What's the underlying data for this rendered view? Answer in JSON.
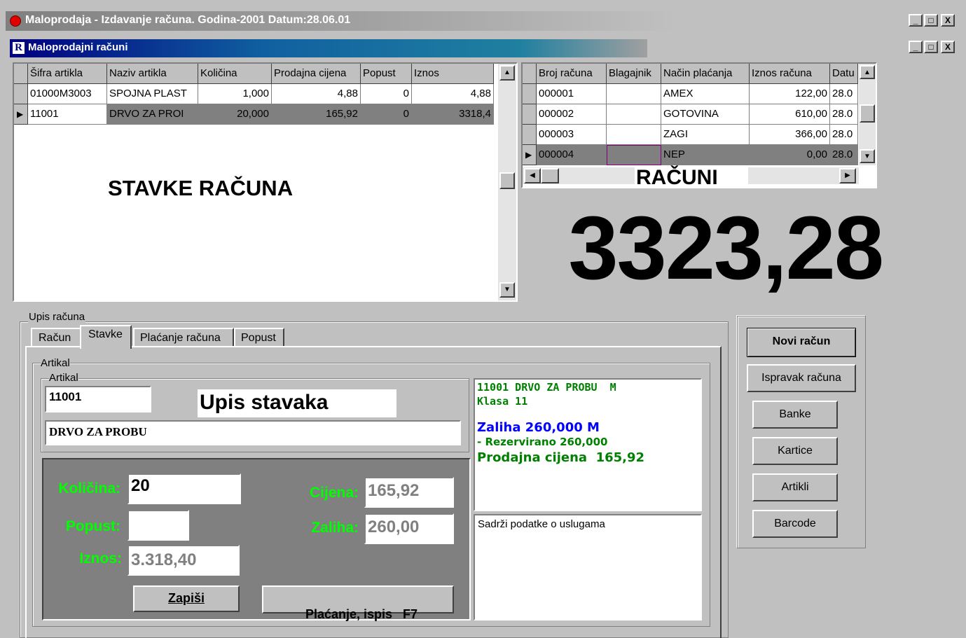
{
  "app": {
    "title": "Maloprodaja - Izdavanje računa. Godina-2001 Datum:28.06.01",
    "window_buttons": [
      "_",
      "□",
      "X"
    ]
  },
  "child": {
    "icon_letter": "R",
    "title": "Maloprodajni računi",
    "window_buttons": [
      "_",
      "□",
      "X"
    ]
  },
  "items_grid": {
    "columns": [
      "Šifra artikla",
      "Naziv artikla",
      "Količina",
      "Prodajna cijena",
      "Popust",
      "Iznos"
    ],
    "rows": [
      [
        "01000M3003",
        "SPOJNA PLAST",
        "1,000",
        "4,88",
        "0",
        "4,88"
      ],
      [
        "11001",
        "DRVO ZA PROI",
        "20,000",
        "165,92",
        "0",
        "3318,4"
      ]
    ],
    "overlay_label": "STAVKE RAČUNA"
  },
  "receipts_grid": {
    "columns": [
      "Broj računa",
      "Blagajnik",
      "Način plaćanja",
      "Iznos računa",
      "Datu"
    ],
    "rows": [
      [
        "000001",
        "",
        "AMEX",
        "122,00",
        "28.0"
      ],
      [
        "000002",
        "",
        "GOTOVINA",
        "610,00",
        "28.0"
      ],
      [
        "000003",
        "",
        "ZAGI",
        "366,00",
        "28.0"
      ],
      [
        "000004",
        "",
        "NEP",
        "0,00",
        "28.0"
      ]
    ],
    "overlay_label": "RAČUNI"
  },
  "total": "3323,28",
  "entry": {
    "group_label": "Upis računa",
    "tabs": [
      "Račun",
      "Stavke",
      "Plaćanje računa",
      "Popust"
    ],
    "active_tab": "Stavke",
    "outer_group": "Artikal",
    "inner_group": "Artikal",
    "code_value": "11001",
    "header_label": "Upis stavaka",
    "name_value": "DRVO ZA PROBU",
    "labels": {
      "kolicina": "Količina:",
      "popust": "Popust:",
      "iznos": "Iznos:",
      "cijena": "Cijena:",
      "zaliha": "Zaliha:"
    },
    "values": {
      "kolicina": "20",
      "popust": "",
      "iznos": "3.318,40",
      "cijena": "165,92",
      "zaliha": "260,00"
    },
    "buttons": {
      "zapisi": "Zapiši",
      "placanje": "Plaćanje, ispis   F7"
    },
    "info": {
      "line1": "11001 DRVO ZA PROBU  M",
      "line2": "Klasa 11",
      "line3": "Zaliha 260,000 M",
      "line4": "- Rezervirano 260,000",
      "line5": "Prodajna cijena  165,92"
    },
    "note": "Sadrži podatke o uslugama"
  },
  "side_buttons": {
    "novi": "Novi račun",
    "ispravak": "Ispravak računa",
    "banke": "Banke",
    "kartice": "Kartice",
    "artikli": "Artikli",
    "barcode": "Barcode"
  },
  "colors": {
    "face": "#c0c0c0",
    "selected_row": "#808080",
    "entry_panel": "#808080",
    "label_green": "#00ff00",
    "info_green": "#008000",
    "info_blue": "#0000ff"
  }
}
